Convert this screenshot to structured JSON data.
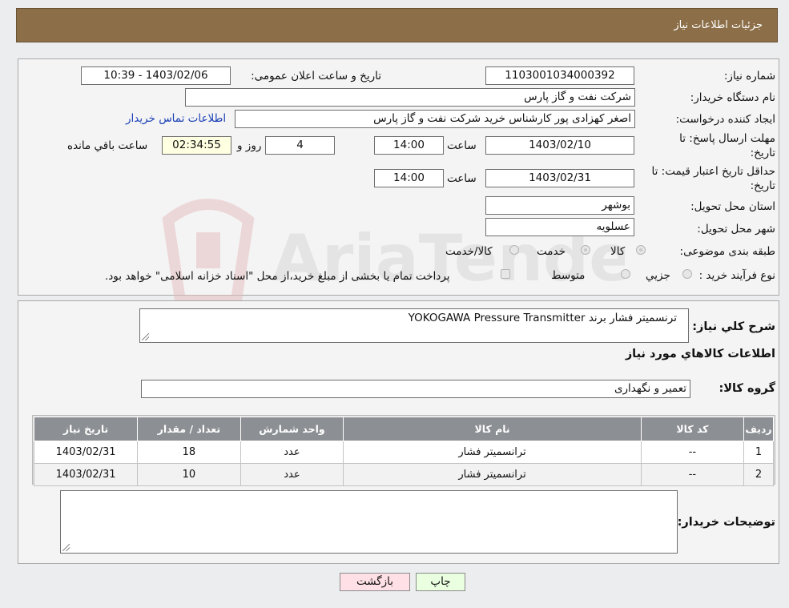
{
  "header": {
    "title": "جزئیات اطلاعات نیاز"
  },
  "info": {
    "need_number_label": "شماره نیاز:",
    "need_number": "1103001034000392",
    "announce_label": "تاریخ و ساعت اعلان عمومی:",
    "announce_value": "1403/02/06 - 10:39",
    "buyer_org_label": "نام دستگاه خریدار:",
    "buyer_org": "شرکت نفت و گاز پارس",
    "creator_label": "ایجاد کننده درخواست:",
    "creator": "اصغر کهزادی پور کارشناس خرید شرکت نفت و گاز پارس",
    "contact_link": "اطلاعات تماس خریدار",
    "deadline_label_1": "مهلت ارسال پاسخ: تا",
    "deadline_label_2": "تاریخ:",
    "deadline_date": "1403/02/10",
    "time_label": "ساعت",
    "deadline_time": "14:00",
    "days_value": "4",
    "days_label": "روز و",
    "remaining_time": "02:34:55",
    "remaining_label": "ساعت باقي مانده",
    "validity_label_1": "حداقل تاریخ اعتبار قیمت: تا",
    "validity_label_2": "تاریخ:",
    "validity_date": "1403/02/31",
    "validity_time": "14:00",
    "province_label": "استان محل تحویل:",
    "province": "بوشهر",
    "city_label": "شهر محل تحویل:",
    "city": "عسلویه",
    "category_label": "طبقه بندی موضوعی:",
    "category_options": [
      "کالا",
      "خدمت",
      "کالا/خدمت"
    ],
    "process_label": "نوع فرآیند خرید :",
    "process_options": [
      "جزیي",
      "متوسط"
    ],
    "process_note": "پرداخت تمام یا بخشی از مبلغ خرید،از محل \"اسناد خزانه اسلامی\" خواهد بود."
  },
  "detail": {
    "summary_label": "شرح کلي نیاز:",
    "summary_value": "ترنسمیتر فشار برند YOKOGAWA Pressure Transmitter",
    "goods_info_title": "اطلاعات کالاهاي مورد نیاز",
    "group_label": "گروه کالا:",
    "group_value": "تعمیر و نگهداری",
    "table": {
      "headers": [
        "ردیف",
        "کد کالا",
        "نام کالا",
        "واحد شمارش",
        "تعداد / مقدار",
        "تاریخ نیاز"
      ],
      "rows": [
        [
          "1",
          "--",
          "ترانسمیتر فشار",
          "عدد",
          "18",
          "1403/02/31"
        ],
        [
          "2",
          "--",
          "ترانسمیتر فشار",
          "عدد",
          "10",
          "1403/02/31"
        ]
      ]
    },
    "buyer_notes_label": "توضیحات خریدار:",
    "buyer_notes_value": ""
  },
  "buttons": {
    "print": "چاپ",
    "back": "بازگشت"
  },
  "watermark": {
    "text": "AriaTender.neT"
  },
  "colors": {
    "header": "#8c6e48",
    "table_header": "#8c8f93",
    "link": "#1a3fb5",
    "print_btn": "#eaffe0",
    "back_btn": "#ffe0e6"
  }
}
